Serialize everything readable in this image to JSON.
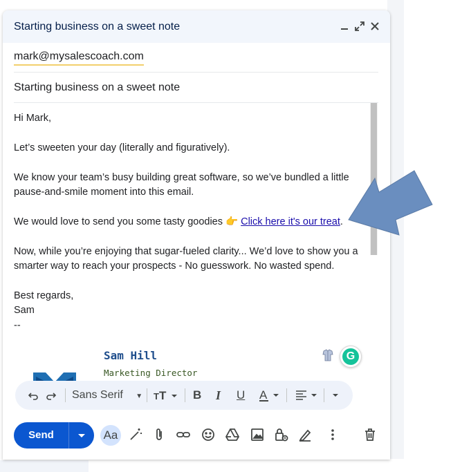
{
  "compose": {
    "title": "Starting business on a sweet note",
    "to": "mark@mysalescoach.com",
    "subject": "Starting business on a sweet note"
  },
  "body": {
    "greeting": "Hi Mark,",
    "line1": "Let’s sweeten your day (literally and figuratively).",
    "line2": "We know your team’s busy building great software, so we’ve bundled a little pause-and-smile moment into this email.",
    "line3_prefix": "We would love to send you some tasty goodies 👉 ",
    "line3_link": "Click here it's our treat",
    "line3_suffix": ".",
    "line4": "Now, while you’re enjoying that sugar-fueled clarity... We’d love to show you a smarter way to reach your prospects - No guesswork. No wasted spend.",
    "closing": "Best regards,",
    "sender": "Sam",
    "dashes": "--"
  },
  "signature": {
    "name": "Sam Hill",
    "role": "Marketing Director"
  },
  "toolbar": {
    "font": "Sans Serif",
    "send": "Send",
    "aa": "Aa"
  },
  "grammarly": {
    "letter": "G"
  },
  "colors": {
    "accent": "#0b57d0",
    "titlebar": "#f2f6fc",
    "formatbar": "#eef2fa",
    "arrow": "#6a8ebf",
    "link": "#1a0dab"
  }
}
